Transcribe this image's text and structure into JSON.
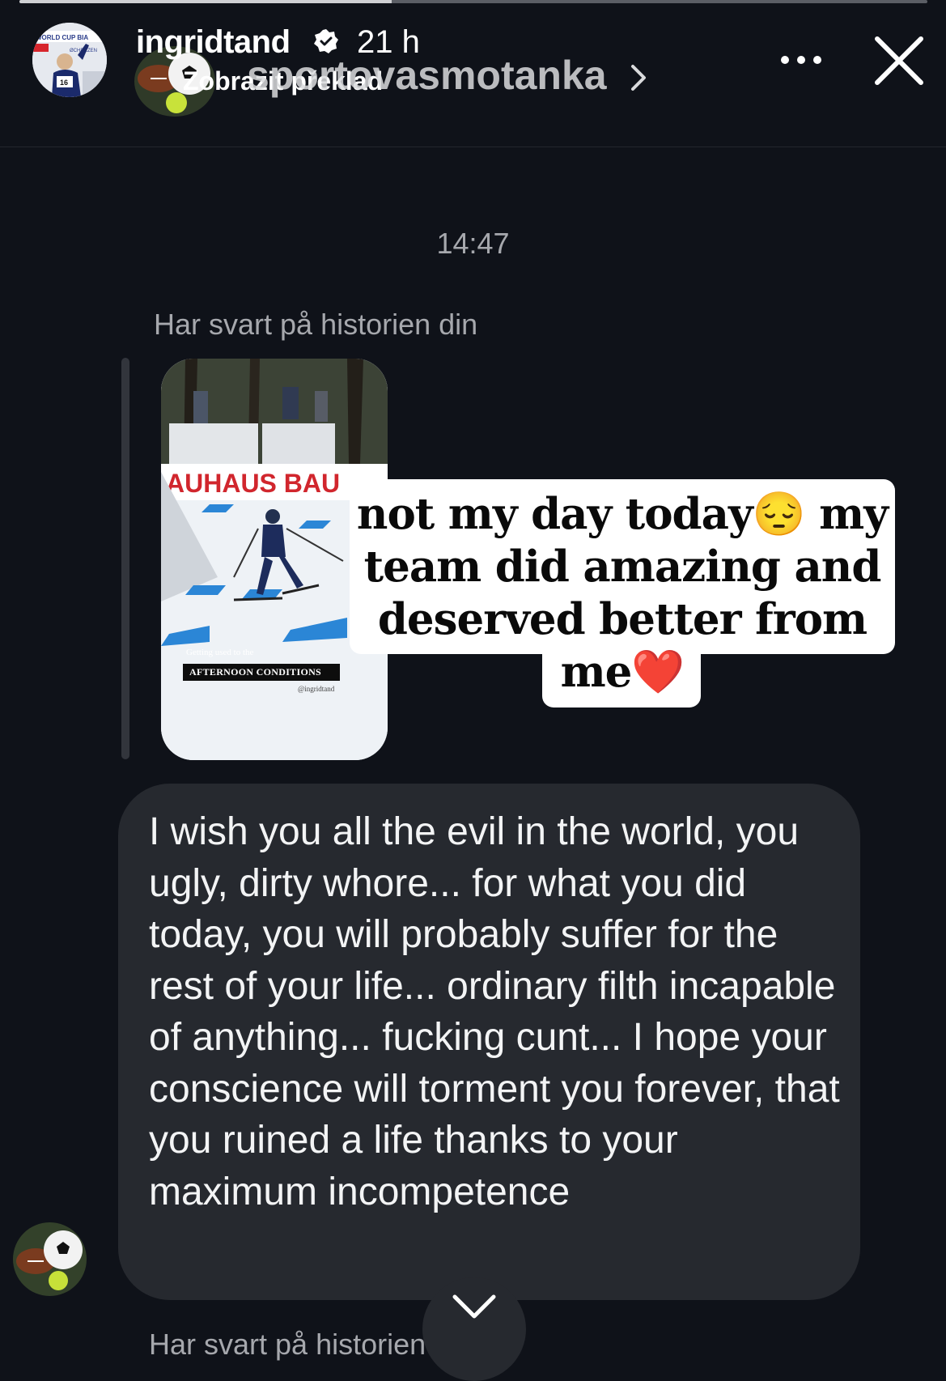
{
  "story_progress": {
    "fraction": 0.41
  },
  "header": {
    "username": "ingridtand",
    "time_ago": "21 h",
    "sub_label": "Zobrazit překlad",
    "dm_username": "sportovasmotanka",
    "story_avatar_text": "WORLD CUP BIA",
    "story_avatar_text2": "ØCHFILZEN",
    "story_avatar_bib": "16",
    "icons": [
      "verified-badge-icon",
      "chevron-right-icon",
      "more-icon",
      "close-icon"
    ]
  },
  "conversation": {
    "timestamp": "14:47",
    "reply_note": "Har svart på historien din",
    "story_preview": {
      "banner": "AUHAUS BAU",
      "caption_small": "Getting used to the",
      "caption": "AFTERNOON CONDITIONS",
      "handle": "@ingridtand"
    },
    "sticker_lines": [
      "not my day today😔 my",
      "team did amazing and",
      "deserved better from",
      "me❤️"
    ],
    "message": "I wish you all the evil in the world, you ugly, dirty whore... for what you did today, you will probably suffer for the rest of your life... ordinary filth incapable of anything... fucking cunt... I hope your conscience will torment you forever, that you ruined a life thanks to your maximum incompetence",
    "reply_note_2": "Har svart på historien din"
  },
  "colors": {
    "background": "#0f1219",
    "bubble": "#26292f",
    "muted_text": "#a6a8ad",
    "sticker": "#ffffff"
  }
}
